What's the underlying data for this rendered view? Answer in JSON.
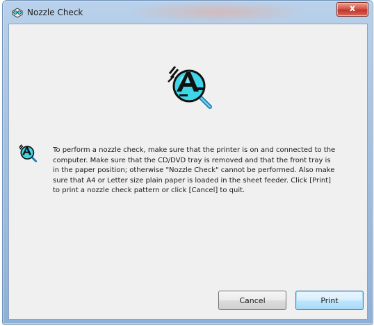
{
  "window": {
    "title": "Nozzle Check",
    "close_label": "x",
    "app_icon": "printer-check-icon"
  },
  "content": {
    "hero_icon": "nozzle-check-magnifier-icon",
    "message_icon": "nozzle-check-magnifier-icon",
    "message": "To perform a nozzle check, make sure that the printer is on and connected to the computer. Make sure that the CD/DVD tray is removed and that the front tray is in the paper position; otherwise \"Nozzle Check\" cannot be performed. Also make sure that A4 or Letter size plain paper is loaded in the sheet feeder. Click [Print] to print a nozzle check pattern or click [Cancel] to quit."
  },
  "buttons": {
    "cancel_label": "Cancel",
    "print_label": "Print"
  },
  "colors": {
    "icon_cyan": "#3fd6e8",
    "close_red": "#c9463a",
    "default_button_border": "#3c7fb1"
  }
}
